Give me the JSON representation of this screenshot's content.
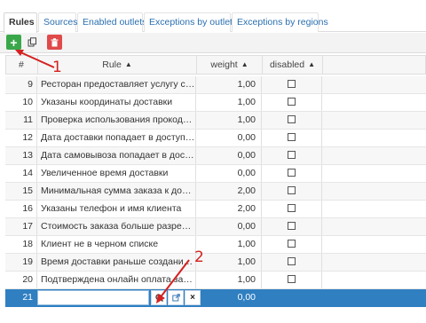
{
  "tabs": [
    {
      "label": "Rules",
      "active": true
    },
    {
      "label": "Sources",
      "active": false
    },
    {
      "label": "Enabled outlets",
      "active": false
    },
    {
      "label": "Exceptions by outlets",
      "active": false
    },
    {
      "label": "Exceptions by regions",
      "active": false
    }
  ],
  "toolbar": {
    "add_icon": "plus-icon",
    "copy_icon": "copy-icon",
    "delete_icon": "trash-icon",
    "add_color": "#3aa84a",
    "delete_color": "#e04a4a"
  },
  "columns": {
    "num": "#",
    "rule": "Rule",
    "weight": "weight",
    "disabled": "disabled"
  },
  "rows": [
    {
      "num": "9",
      "rule": "Ресторан предоставляет услугу самовывоза",
      "weight": "1,00"
    },
    {
      "num": "10",
      "rule": "Указаны координаты доставки",
      "weight": "1,00"
    },
    {
      "num": "11",
      "rule": "Проверка использования прокода на заказ",
      "weight": "1,00"
    },
    {
      "num": "12",
      "rule": "Дата доставки попадает в доступный интервал",
      "weight": "0,00"
    },
    {
      "num": "13",
      "rule": "Дата самовывоза попадает в доступный интервал",
      "weight": "0,00"
    },
    {
      "num": "14",
      "rule": "Увеличенное время доставки",
      "weight": "0,00"
    },
    {
      "num": "15",
      "rule": "Минимальная сумма заказа к доставке",
      "weight": "2,00"
    },
    {
      "num": "16",
      "rule": "Указаны телефон и имя клиента",
      "weight": "2,00"
    },
    {
      "num": "17",
      "rule": "Стоимость заказа больше разрешенной",
      "weight": "0,00"
    },
    {
      "num": "18",
      "rule": "Клиент не в черном списке",
      "weight": "1,00"
    },
    {
      "num": "19",
      "rule": "Время доставки раньше создания заказа",
      "weight": "1,00"
    },
    {
      "num": "20",
      "rule": "Подтверждена онлайн оплата заказа",
      "weight": "1,00"
    }
  ],
  "selected_row": {
    "num": "21",
    "rule_value": "",
    "weight": "0,00"
  },
  "annotations": {
    "label_1": "1",
    "label_2": "2",
    "color": "#d42020"
  },
  "selection_color": "#2f7fc1"
}
